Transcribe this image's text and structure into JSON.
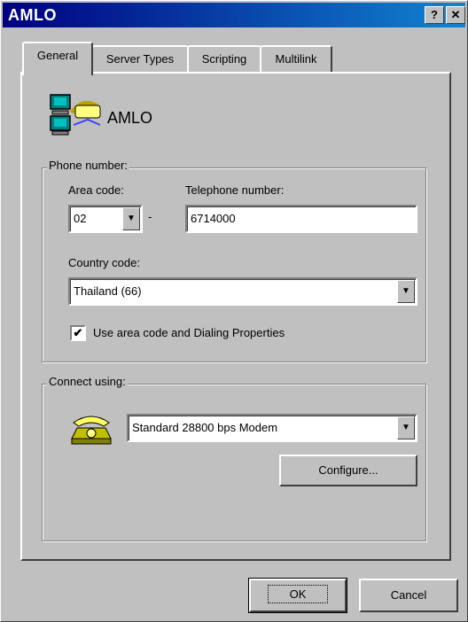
{
  "window": {
    "title": "AMLO",
    "help_glyph": "?",
    "close_glyph": "✕"
  },
  "tabs": [
    "General",
    "Server Types",
    "Scripting",
    "Multilink"
  ],
  "connection_name": "AMLO",
  "phone_group": {
    "label": "Phone number:",
    "area_code_label": "Area code:",
    "area_code_value": "02",
    "dash": "-",
    "telephone_label": "Telephone number:",
    "telephone_value": "6714000",
    "country_label": "Country code:",
    "country_value": "Thailand (66)",
    "use_area_code_label": "Use area code and Dialing Properties",
    "use_area_code_checked": "✔"
  },
  "connect_group": {
    "label": "Connect using:",
    "modem_value": "Standard 28800 bps Modem",
    "configure_label": "Configure..."
  },
  "footer": {
    "ok_label": "OK",
    "cancel_label": "Cancel"
  },
  "colors": {
    "titlebar_start": "#000080",
    "titlebar_end": "#1084d0",
    "face": "#c0c0c0"
  }
}
